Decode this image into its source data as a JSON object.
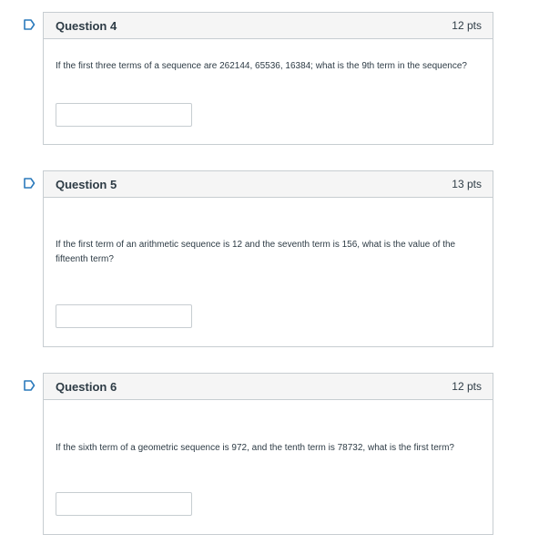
{
  "questions": [
    {
      "title": "Question 4",
      "points": "12 pts",
      "text": "If the first three terms of a sequence are 262144, 65536, 16384; what is the 9th term in the sequence?",
      "answer_value": ""
    },
    {
      "title": "Question 5",
      "points": "13 pts",
      "text": "If the first term of an arithmetic sequence is 12 and the seventh term is 156, what is the value of the fifteenth term?",
      "answer_value": ""
    },
    {
      "title": "Question 6",
      "points": "12 pts",
      "text": "If the sixth term of a geometric sequence is 972, and the tenth term is 78732, what is the first term?",
      "answer_value": ""
    }
  ],
  "colors": {
    "flag": "#2b7abc",
    "border": "#c7cdd1",
    "header_bg": "#f5f5f5",
    "text": "#2d3b45"
  },
  "icons": {
    "flag": "flag-bookmark-icon"
  }
}
